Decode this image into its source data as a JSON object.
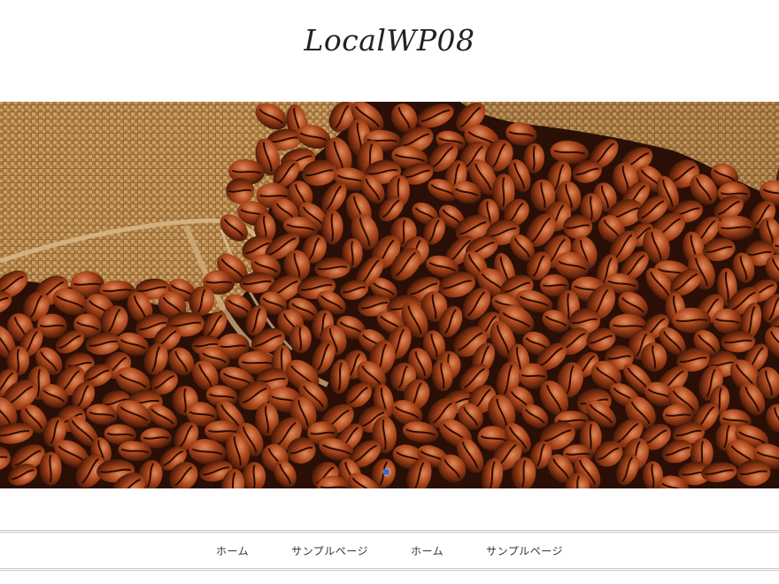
{
  "site": {
    "title": "LocalWP08"
  },
  "hero": {
    "image_description_icon": "coffee-beans-burlap-sack-image",
    "colors": {
      "burlap": "#b9894f",
      "bean_dark": "#3d1406",
      "bean_mid": "#8a3512",
      "bean_light": "#c6683a",
      "background": "#2a0f06"
    }
  },
  "slider": {
    "active_dot_color": "#2f6fd6"
  },
  "nav": {
    "items": [
      {
        "label": "ホーム"
      },
      {
        "label": "サンプルページ"
      },
      {
        "label": "ホーム"
      },
      {
        "label": "サンプルページ"
      }
    ]
  }
}
